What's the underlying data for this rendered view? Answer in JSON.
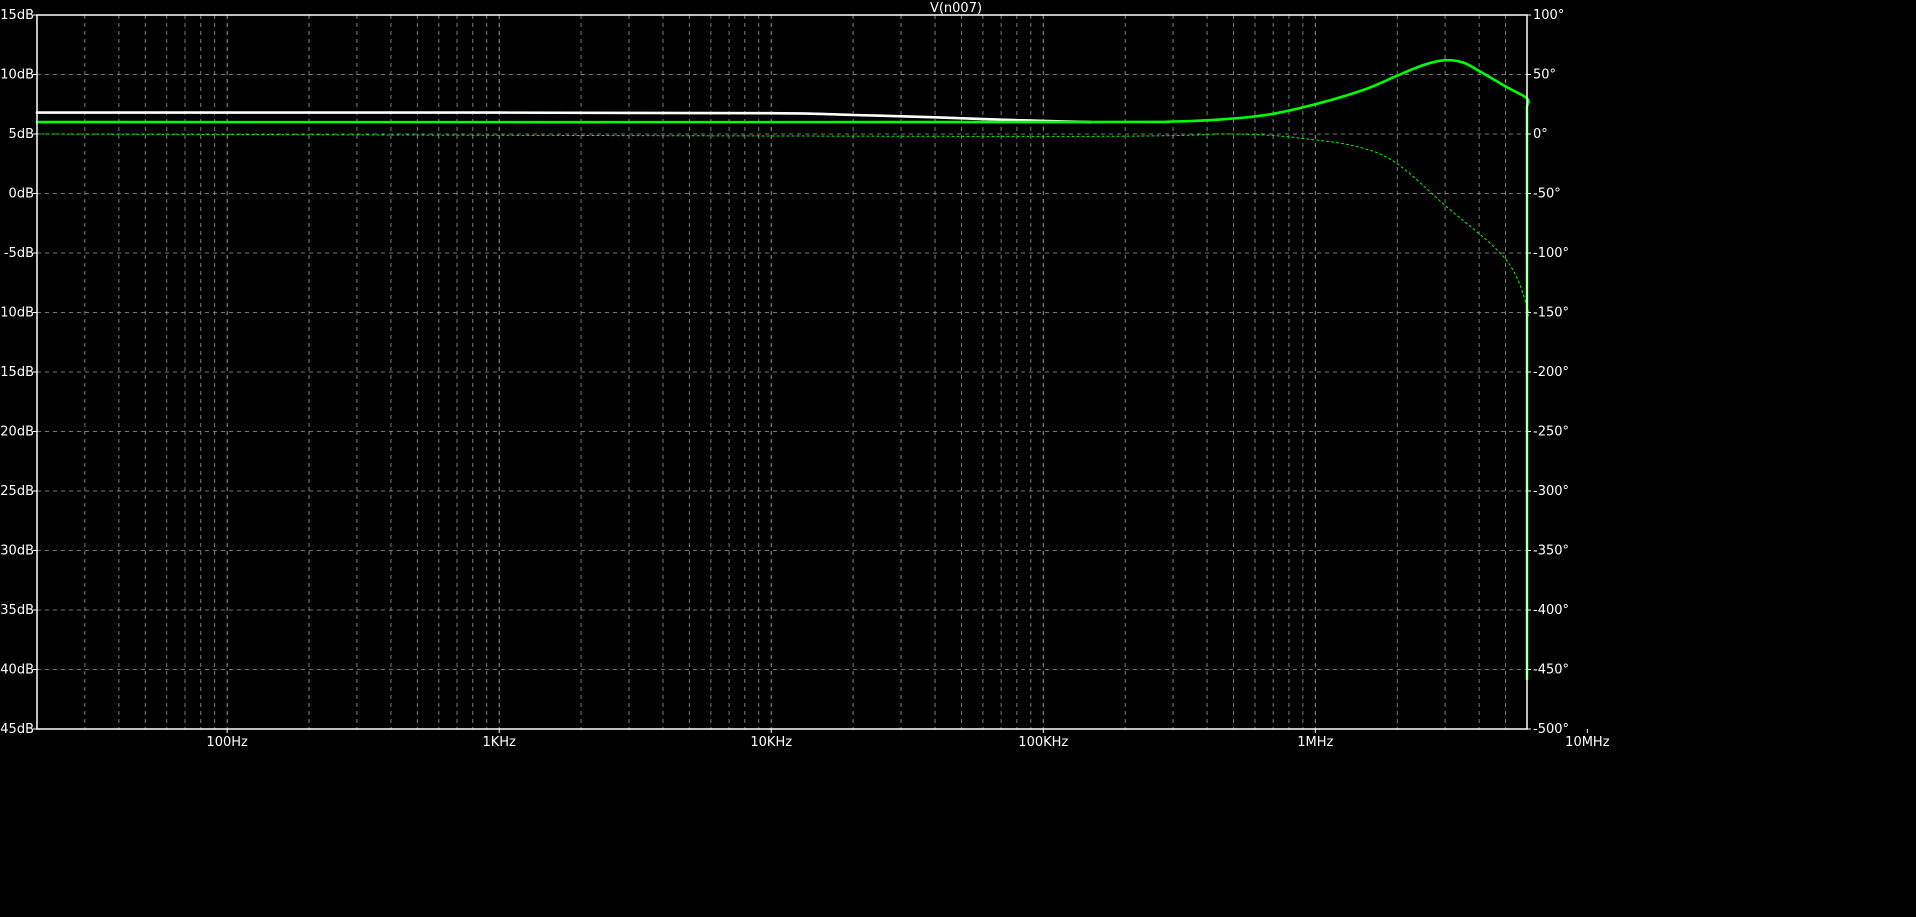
{
  "chart_data": {
    "type": "line",
    "title": "V(n007)",
    "xscale": "log",
    "xlim": [
      20,
      6000000
    ],
    "ylim_left": [
      -45,
      15
    ],
    "ylim_right": [
      -500,
      100
    ],
    "grid": true,
    "x_ticks": [
      {
        "value": 100,
        "label": "100Hz"
      },
      {
        "value": 1000,
        "label": "1KHz"
      },
      {
        "value": 10000,
        "label": "10KHz"
      },
      {
        "value": 100000,
        "label": "100KHz"
      },
      {
        "value": 1000000,
        "label": "1MHz"
      },
      {
        "value": 10000000,
        "label": "10MHz"
      }
    ],
    "y_left_ticks": [
      {
        "value": 15,
        "label": "15dB"
      },
      {
        "value": 10,
        "label": "10dB"
      },
      {
        "value": 5,
        "label": "5dB"
      },
      {
        "value": 0,
        "label": "0dB"
      },
      {
        "value": -5,
        "label": "-5dB"
      },
      {
        "value": -10,
        "label": "-10dB"
      },
      {
        "value": -15,
        "label": "-15dB"
      },
      {
        "value": -20,
        "label": "-20dB"
      },
      {
        "value": -25,
        "label": "-25dB"
      },
      {
        "value": -30,
        "label": "-30dB"
      },
      {
        "value": -35,
        "label": "-35dB"
      },
      {
        "value": -40,
        "label": "-40dB"
      },
      {
        "value": -45,
        "label": "-45dB"
      }
    ],
    "y_right_ticks": [
      {
        "value": 100,
        "label": "100°"
      },
      {
        "value": 50,
        "label": "50°"
      },
      {
        "value": 0,
        "label": "0°"
      },
      {
        "value": -50,
        "label": "-50°"
      },
      {
        "value": -100,
        "label": "-100°"
      },
      {
        "value": -150,
        "label": "-150°"
      },
      {
        "value": -200,
        "label": "-200°"
      },
      {
        "value": -250,
        "label": "-250°"
      },
      {
        "value": -300,
        "label": "-300°"
      },
      {
        "value": -350,
        "label": "-350°"
      },
      {
        "value": -400,
        "label": "-400°"
      },
      {
        "value": -450,
        "label": "-450°"
      },
      {
        "value": -500,
        "label": "-500°"
      }
    ],
    "series": [
      {
        "axis": "left",
        "color": "#ffffff",
        "style": "solid",
        "x": [
          20,
          1000,
          10000,
          20000,
          40000,
          70000,
          100000,
          150000
        ],
        "y": [
          6.8,
          6.8,
          6.75,
          6.6,
          6.4,
          6.2,
          6.1,
          6.0
        ]
      },
      {
        "axis": "left",
        "color": "#00ff00",
        "style": "solid",
        "x": [
          20,
          100000,
          300000,
          500000,
          700000,
          1000000,
          1500000,
          2000000,
          2500000,
          3000000,
          3500000,
          4000000,
          5000000,
          6000000,
          7000000,
          8000000,
          9000000,
          10000000,
          11000000,
          12000000,
          13000000,
          15000000,
          17000000,
          20000000,
          25000000,
          30000000,
          35000000,
          40000000,
          45000000,
          50000000,
          55000000,
          60000000
        ],
        "y": [
          6.0,
          6.0,
          6.05,
          6.3,
          6.7,
          7.5,
          8.7,
          9.9,
          10.8,
          11.2,
          11.0,
          10.3,
          9.0,
          8.0,
          7.3,
          6.8,
          6.2,
          5.2,
          3.9,
          2.4,
          0.7,
          -3.3,
          -7.5,
          -13.5,
          -21.3,
          -27.4,
          -31.5,
          -34.0,
          -36.0,
          -37.8,
          -39.5,
          -40.8
        ]
      },
      {
        "axis": "right",
        "color": "#00ff00",
        "style": "dashed",
        "x": [
          20,
          100000,
          500000,
          1000000,
          1500000,
          2000000,
          3000000,
          5000000,
          7000000,
          8000000,
          10000000,
          15000000,
          20000000,
          30000000,
          40000000,
          50000000,
          60000000
        ],
        "y": [
          0,
          -2,
          0,
          -5,
          -12,
          -25,
          -60,
          -105,
          -145,
          -160,
          -200,
          -280,
          -330,
          -380,
          -405,
          -425,
          -445
        ]
      }
    ]
  }
}
